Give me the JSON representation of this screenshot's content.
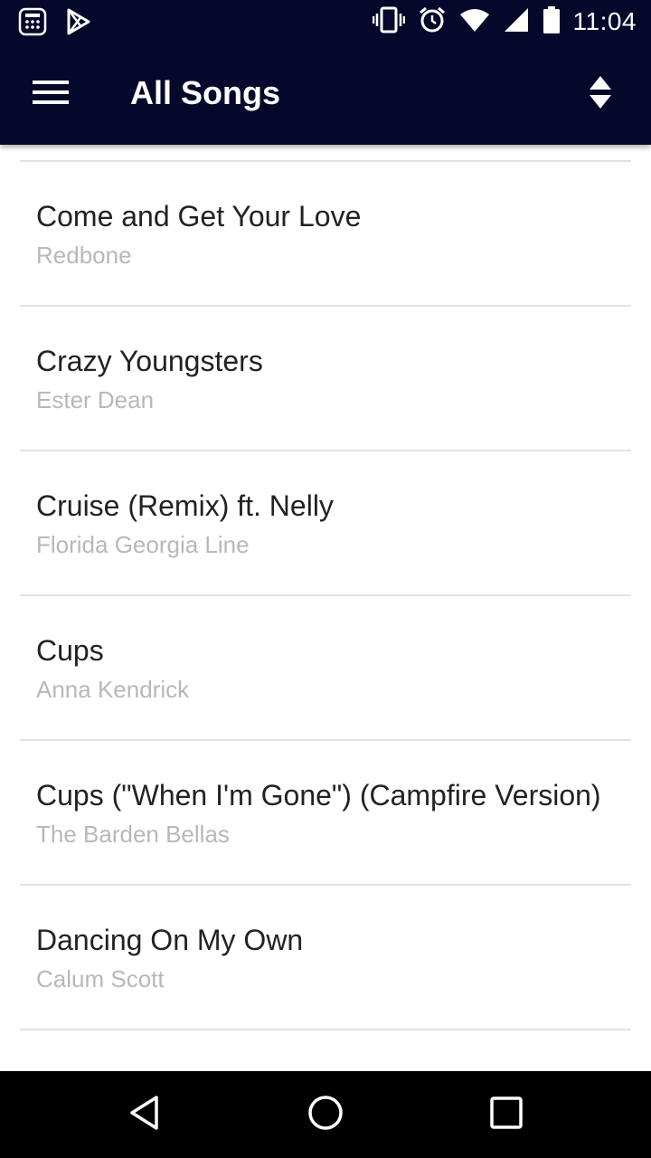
{
  "status_bar": {
    "time": "11:04",
    "left_icons": [
      "calculator-icon",
      "play-store-icon"
    ],
    "right_icons": [
      "vibrate-icon",
      "alarm-icon",
      "wifi-icon",
      "signal-icon",
      "battery-icon"
    ]
  },
  "app_bar": {
    "title": "All Songs",
    "menu_icon": "hamburger-menu-icon",
    "sort_icon": "sort-icon",
    "background": "#05082a"
  },
  "songs": [
    {
      "title": "Come and Get Your Love",
      "artist": "Redbone"
    },
    {
      "title": "Crazy Youngsters",
      "artist": "Ester Dean"
    },
    {
      "title": "Cruise (Remix) ft. Nelly",
      "artist": "Florida Georgia Line"
    },
    {
      "title": "Cups",
      "artist": "Anna Kendrick"
    },
    {
      "title": "Cups (\"When I'm Gone\") (Campfire Version)",
      "artist": "The Barden Bellas"
    },
    {
      "title": "Dancing On My Own",
      "artist": "Calum Scott"
    }
  ],
  "nav_bar": {
    "buttons": [
      "back-icon",
      "home-icon",
      "recents-icon"
    ]
  }
}
